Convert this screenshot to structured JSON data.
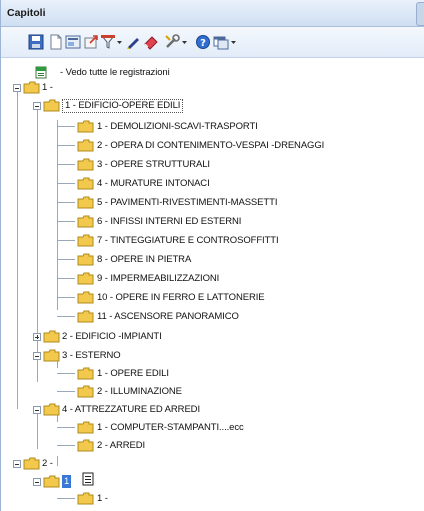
{
  "window": {
    "title": "Capitoli"
  },
  "toolbar": {
    "buttons": [
      {
        "name": "save-icon"
      },
      {
        "name": "new-document-icon"
      },
      {
        "name": "print-preview-icon"
      },
      {
        "name": "export-icon"
      },
      {
        "name": "filter-icon"
      },
      {
        "name": "dropdown-arrow-icon"
      },
      {
        "name": "pen-icon"
      },
      {
        "name": "eraser-icon"
      },
      {
        "name": "tools-icon"
      },
      {
        "name": "dropdown-arrow-icon"
      },
      {
        "name": "help-icon"
      },
      {
        "name": "window-icon"
      },
      {
        "name": "dropdown-arrow-icon"
      }
    ]
  },
  "tree": {
    "all_records": "- Vedo tutte le registrazioni",
    "n1": "1 -",
    "n1_1": "1 - EDIFICIO-OPERE EDILI",
    "n1_1_items": [
      "1 - DEMOLIZIONI-SCAVI-TRASPORTI",
      "2 - OPERA DI CONTENIMENTO-VESPAI -DRENAGGI",
      "3 - OPERE STRUTTURALI",
      "4 - MURATURE INTONACI",
      "5 - PAVIMENTI-RIVESTIMENTI-MASSETTI",
      "6 - INFISSI INTERNI ED ESTERNI",
      "7 - TINTEGGIATURE E CONTROSOFFITTI",
      "8 - OPERE IN PIETRA",
      "9 - IMPERMEABILIZZAZIONI",
      "10 - OPERE IN FERRO E LATTONERIE",
      "11 - ASCENSORE PANORAMICO"
    ],
    "n1_2": "2 - EDIFICIO -IMPIANTI",
    "n1_3": "3 - ESTERNO",
    "n1_3_items": [
      "1 - OPERE EDILI",
      "2 - ILLUMINAZIONE"
    ],
    "n1_4": "4 - ATTREZZATURE ED ARREDI",
    "n1_4_items": [
      "1 - COMPUTER-STAMPANTI....ecc",
      "2 - ARREDI"
    ],
    "n2": "2 -",
    "n2_1": "1",
    "n2_1_1": "1 -"
  },
  "colors": {
    "selection": "#3a78d8",
    "folder": "#f2c94c"
  }
}
